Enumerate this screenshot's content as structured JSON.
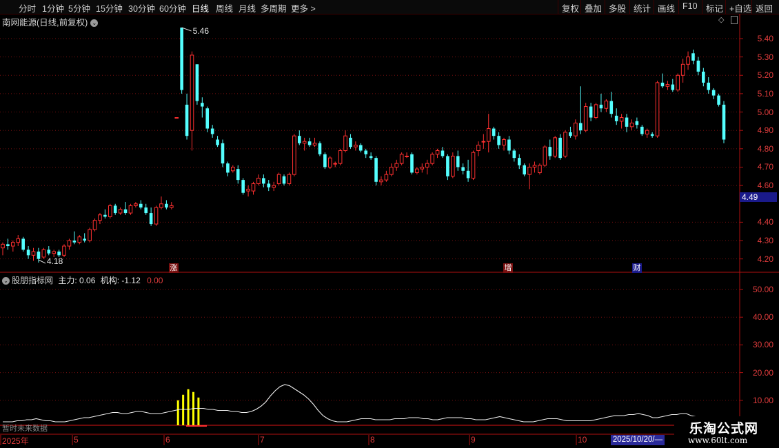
{
  "toolbar": {
    "periods": [
      "分时",
      "1分钟",
      "5分钟",
      "15分钟",
      "30分钟",
      "60分钟",
      "日线",
      "周线",
      "月线",
      "多周期",
      "更多 >"
    ],
    "active_period": "日线",
    "actions": [
      "复权",
      "叠加",
      "多股",
      "统计",
      "画线",
      "F10",
      "标记",
      "+自选",
      "返回"
    ]
  },
  "stock": {
    "title": "南网能源(日线,前复权)"
  },
  "main_chart": {
    "y_ticks": [
      "5.40",
      "5.30",
      "5.20",
      "5.10",
      "5.00",
      "4.90",
      "4.80",
      "4.70",
      "4.60",
      "4.40",
      "4.30",
      "4.20"
    ],
    "current_price": "4.49",
    "high_label": "5.46",
    "low_label": "4.18",
    "events": [
      "涨",
      "增",
      "财"
    ]
  },
  "indicator": {
    "name": "股朋指标网",
    "main_force_label": "主力: 0.06",
    "institution_label": "机构: -1.12",
    "extra_value": "0.00",
    "y_ticks": [
      "50.00",
      "40.00",
      "30.00",
      "20.00",
      "10.00"
    ],
    "no_data_text": "暂时未来数据"
  },
  "date_axis": {
    "labels": [
      "2025年",
      "5",
      "6",
      "7",
      "8",
      "9",
      "10"
    ],
    "cursor_date": "2025/10/20/—"
  },
  "watermark": {
    "line1": "乐淘公式网",
    "line2": "www.60lt.com"
  },
  "chart_data": {
    "type": "candlestick",
    "ylim": [
      4.16,
      5.47
    ],
    "up_color": "#ff3030",
    "down_color": "#54ffff",
    "indicator_ylim": [
      0,
      55
    ],
    "candles": [
      [
        4.26,
        4.29,
        4.22,
        4.28
      ],
      [
        4.28,
        4.31,
        4.25,
        4.27
      ],
      [
        4.27,
        4.3,
        4.24,
        4.29
      ],
      [
        4.29,
        4.33,
        4.27,
        4.31
      ],
      [
        4.31,
        4.32,
        4.24,
        4.25
      ],
      [
        4.25,
        4.27,
        4.2,
        4.22
      ],
      [
        4.22,
        4.26,
        4.19,
        4.24
      ],
      [
        4.24,
        4.26,
        4.18,
        4.2
      ],
      [
        4.21,
        4.26,
        4.2,
        4.25
      ],
      [
        4.25,
        4.27,
        4.22,
        4.23
      ],
      [
        4.23,
        4.25,
        4.21,
        4.24
      ],
      [
        4.24,
        4.25,
        4.21,
        4.22
      ],
      [
        4.22,
        4.28,
        4.21,
        4.27
      ],
      [
        4.27,
        4.31,
        4.25,
        4.3
      ],
      [
        4.3,
        4.35,
        4.28,
        4.29
      ],
      [
        4.29,
        4.33,
        4.28,
        4.32
      ],
      [
        4.31,
        4.34,
        4.29,
        4.3
      ],
      [
        4.3,
        4.37,
        4.29,
        4.36
      ],
      [
        4.36,
        4.42,
        4.35,
        4.41
      ],
      [
        4.41,
        4.45,
        4.39,
        4.44
      ],
      [
        4.44,
        4.47,
        4.42,
        4.43
      ],
      [
        4.43,
        4.5,
        4.42,
        4.49
      ],
      [
        4.49,
        4.5,
        4.44,
        4.45
      ],
      [
        4.45,
        4.48,
        4.44,
        4.47
      ],
      [
        4.47,
        4.51,
        4.44,
        4.45
      ],
      [
        4.45,
        4.5,
        4.44,
        4.49
      ],
      [
        4.49,
        4.51,
        4.48,
        4.5
      ],
      [
        4.5,
        4.52,
        4.47,
        4.48
      ],
      [
        4.48,
        4.5,
        4.44,
        4.45
      ],
      [
        4.45,
        4.48,
        4.38,
        4.39
      ],
      [
        4.39,
        4.49,
        4.38,
        4.48
      ],
      [
        4.48,
        4.54,
        4.47,
        4.5
      ],
      [
        4.5,
        4.52,
        4.47,
        4.48
      ],
      [
        4.48,
        4.51,
        4.47,
        4.49
      ],
      [
        4.97,
        4.97,
        4.97,
        4.97
      ],
      [
        5.46,
        5.46,
        5.1,
        5.12
      ],
      [
        5.04,
        5.1,
        4.85,
        4.87
      ],
      [
        4.9,
        5.33,
        4.79,
        5.31
      ],
      [
        5.26,
        5.26,
        5.04,
        5.06
      ],
      [
        5.05,
        5.08,
        4.97,
        5.03
      ],
      [
        5.02,
        5.03,
        4.89,
        4.91
      ],
      [
        4.91,
        4.93,
        4.86,
        4.88
      ],
      [
        4.85,
        4.87,
        4.81,
        4.82
      ],
      [
        4.83,
        4.85,
        4.7,
        4.72
      ],
      [
        4.72,
        4.73,
        4.65,
        4.67
      ],
      [
        4.68,
        4.71,
        4.67,
        4.7
      ],
      [
        4.69,
        4.71,
        4.61,
        4.63
      ],
      [
        4.63,
        4.64,
        4.55,
        4.56
      ],
      [
        4.57,
        4.6,
        4.54,
        4.58
      ],
      [
        4.57,
        4.62,
        4.55,
        4.61
      ],
      [
        4.61,
        4.66,
        4.6,
        4.64
      ],
      [
        4.64,
        4.66,
        4.59,
        4.61
      ],
      [
        4.61,
        4.63,
        4.57,
        4.59
      ],
      [
        4.59,
        4.62,
        4.57,
        4.6
      ],
      [
        4.61,
        4.67,
        4.6,
        4.66
      ],
      [
        4.65,
        4.66,
        4.6,
        4.61
      ],
      [
        4.61,
        4.67,
        4.6,
        4.66
      ],
      [
        4.66,
        4.88,
        4.65,
        4.87
      ],
      [
        4.87,
        4.9,
        4.82,
        4.83
      ],
      [
        4.83,
        4.86,
        4.79,
        4.84
      ],
      [
        4.84,
        4.86,
        4.81,
        4.82
      ],
      [
        4.82,
        4.86,
        4.81,
        4.83
      ],
      [
        4.83,
        4.84,
        4.76,
        4.77
      ],
      [
        4.77,
        4.78,
        4.69,
        4.7
      ],
      [
        4.7,
        4.76,
        4.69,
        4.75
      ],
      [
        4.72,
        4.73,
        4.7,
        4.72
      ],
      [
        4.72,
        4.8,
        4.71,
        4.79
      ],
      [
        4.79,
        4.9,
        4.78,
        4.87
      ],
      [
        4.86,
        4.88,
        4.8,
        4.81
      ],
      [
        4.81,
        4.84,
        4.79,
        4.82
      ],
      [
        4.82,
        4.83,
        4.78,
        4.79
      ],
      [
        4.79,
        4.8,
        4.75,
        4.77
      ],
      [
        4.76,
        4.78,
        4.74,
        4.75
      ],
      [
        4.75,
        4.76,
        4.6,
        4.62
      ],
      [
        4.62,
        4.65,
        4.6,
        4.63
      ],
      [
        4.63,
        4.68,
        4.62,
        4.66
      ],
      [
        4.66,
        4.72,
        4.65,
        4.7
      ],
      [
        4.7,
        4.74,
        4.68,
        4.72
      ],
      [
        4.72,
        4.78,
        4.71,
        4.77
      ],
      [
        4.76,
        4.78,
        4.75,
        4.76
      ],
      [
        4.77,
        4.78,
        4.66,
        4.67
      ],
      [
        4.67,
        4.7,
        4.66,
        4.69
      ],
      [
        4.69,
        4.72,
        4.67,
        4.7
      ],
      [
        4.7,
        4.74,
        4.66,
        4.72
      ],
      [
        4.72,
        4.78,
        4.71,
        4.77
      ],
      [
        4.77,
        4.8,
        4.75,
        4.79
      ],
      [
        4.79,
        4.81,
        4.75,
        4.76
      ],
      [
        4.76,
        4.77,
        4.63,
        4.65
      ],
      [
        4.65,
        4.78,
        4.64,
        4.76
      ],
      [
        4.76,
        4.79,
        4.68,
        4.7
      ],
      [
        4.7,
        4.72,
        4.66,
        4.68
      ],
      [
        4.68,
        4.74,
        4.62,
        4.64
      ],
      [
        4.64,
        4.79,
        4.63,
        4.78
      ],
      [
        4.79,
        4.84,
        4.76,
        4.82
      ],
      [
        4.84,
        4.88,
        4.8,
        4.84
      ],
      [
        4.84,
        4.99,
        4.78,
        4.91
      ],
      [
        4.91,
        4.92,
        4.85,
        4.87
      ],
      [
        4.87,
        4.89,
        4.8,
        4.82
      ],
      [
        4.82,
        4.86,
        4.79,
        4.85
      ],
      [
        4.85,
        4.87,
        4.77,
        4.79
      ],
      [
        4.79,
        4.8,
        4.73,
        4.75
      ],
      [
        4.75,
        4.77,
        4.69,
        4.71
      ],
      [
        4.71,
        4.72,
        4.65,
        4.66
      ],
      [
        4.66,
        4.72,
        4.58,
        4.7
      ],
      [
        4.7,
        4.73,
        4.67,
        4.71
      ],
      [
        4.67,
        4.72,
        4.66,
        4.71
      ],
      [
        4.71,
        4.82,
        4.7,
        4.81
      ],
      [
        4.81,
        4.85,
        4.74,
        4.76
      ],
      [
        4.76,
        4.87,
        4.75,
        4.86
      ],
      [
        4.86,
        4.88,
        4.74,
        4.75
      ],
      [
        4.76,
        4.9,
        4.75,
        4.89
      ],
      [
        4.89,
        4.92,
        4.86,
        4.87
      ],
      [
        4.87,
        4.96,
        4.85,
        4.94
      ],
      [
        4.94,
        5.14,
        4.88,
        4.9
      ],
      [
        4.9,
        5.05,
        4.89,
        5.03
      ],
      [
        5.03,
        5.05,
        4.95,
        4.97
      ],
      [
        4.97,
        5.05,
        4.96,
        5.04
      ],
      [
        5.04,
        5.1,
        5.0,
        5.02
      ],
      [
        5.02,
        5.07,
        5.0,
        5.06
      ],
      [
        5.06,
        5.11,
        4.97,
        4.99
      ],
      [
        4.98,
        5.02,
        4.93,
        4.95
      ],
      [
        4.95,
        4.99,
        4.91,
        4.97
      ],
      [
        4.97,
        4.99,
        4.89,
        4.92
      ],
      [
        4.92,
        4.96,
        4.9,
        4.94
      ],
      [
        4.95,
        4.97,
        4.91,
        4.93
      ],
      [
        4.92,
        4.93,
        4.87,
        4.88
      ],
      [
        4.88,
        4.91,
        4.86,
        4.9
      ],
      [
        4.88,
        4.89,
        4.86,
        4.87
      ],
      [
        4.87,
        5.17,
        4.86,
        5.16
      ],
      [
        5.16,
        5.21,
        5.13,
        5.14
      ],
      [
        5.14,
        5.17,
        5.12,
        5.15
      ],
      [
        5.15,
        5.18,
        5.11,
        5.12
      ],
      [
        5.12,
        5.21,
        5.11,
        5.2
      ],
      [
        5.2,
        5.29,
        5.16,
        5.26
      ],
      [
        5.26,
        5.33,
        5.23,
        5.3
      ],
      [
        5.32,
        5.34,
        5.26,
        5.28
      ],
      [
        5.28,
        5.3,
        5.2,
        5.22
      ],
      [
        5.22,
        5.24,
        5.14,
        5.16
      ],
      [
        5.16,
        5.19,
        5.1,
        5.12
      ],
      [
        5.12,
        5.13,
        5.07,
        5.09
      ],
      [
        5.09,
        5.1,
        5.03,
        5.04
      ],
      [
        5.04,
        5.06,
        4.83,
        4.85
      ]
    ],
    "main_force_line": [
      0,
      0,
      0,
      1,
      1,
      2,
      2,
      3,
      2,
      1,
      1,
      0,
      0,
      0,
      1,
      2,
      3,
      4,
      4,
      5,
      6,
      7,
      8,
      9,
      9,
      8,
      8,
      9,
      10,
      10,
      9,
      8,
      8,
      8,
      9,
      10,
      11,
      12,
      12,
      12,
      13,
      13,
      13,
      12,
      12,
      11,
      11,
      11,
      10,
      10,
      9,
      9,
      10,
      12,
      15,
      19,
      25,
      30,
      34,
      36,
      35,
      32,
      29,
      26,
      22,
      17,
      11,
      6,
      3,
      1,
      0,
      0,
      0,
      1,
      2,
      3,
      3,
      3,
      2,
      2,
      2,
      2,
      3,
      3,
      3,
      4,
      4,
      4,
      3,
      3,
      2,
      2,
      3,
      4,
      4,
      4,
      4,
      3,
      3,
      2,
      2,
      2,
      3,
      4,
      5,
      4,
      3,
      2,
      1,
      0,
      0,
      0,
      1,
      2,
      3,
      3,
      3,
      2,
      1,
      1,
      1,
      1,
      1,
      1,
      2,
      3,
      4,
      5,
      6,
      6,
      6,
      7,
      7,
      8,
      7,
      6,
      4,
      4,
      5,
      6,
      7,
      7,
      8,
      8,
      6,
      5,
      4,
      3,
      3
    ],
    "institution_bars": [
      10,
      12,
      14,
      13,
      11
    ]
  }
}
